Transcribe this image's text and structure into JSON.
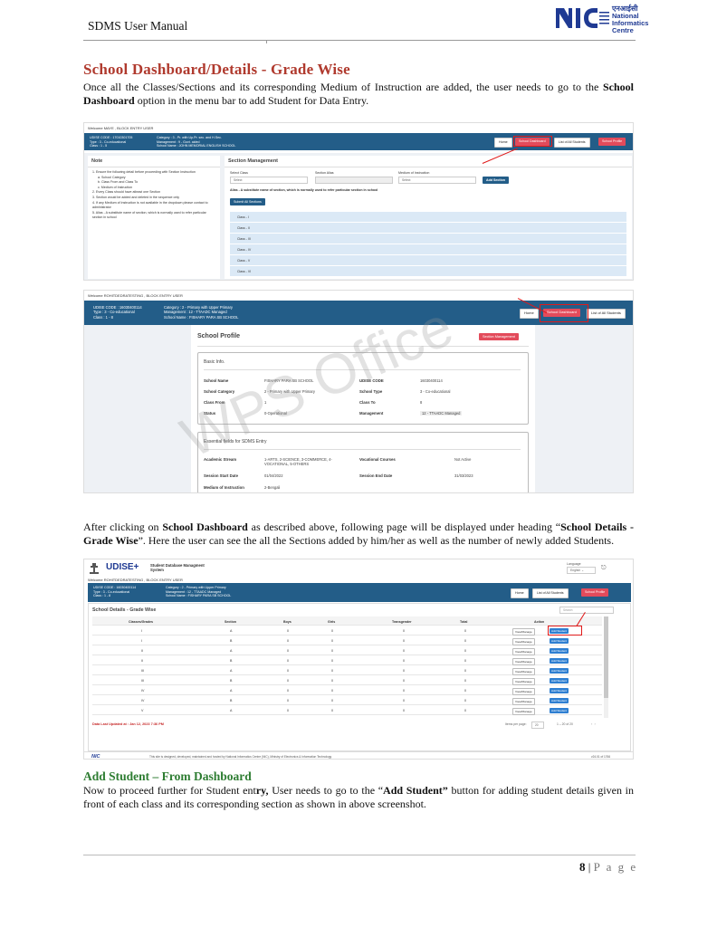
{
  "header": {
    "title": "SDMS User Manual",
    "logo_hindi": "एनआईसी",
    "logo_lines": [
      "National",
      "Informatics",
      "Centre"
    ]
  },
  "section_title": "School Dashboard/Details - Grade Wise",
  "para1": {
    "pre": "Once all the Classes/Sections and its corresponding Medium of Instruction are added, the user needs to go to the ",
    "bold": "School Dashboard",
    "post": " option in the menu bar to add Student for Data Entry."
  },
  "shot1": {
    "welcome": "Welcome MAYE , BLOCK ENTRY USER",
    "info_left": [
      "UDISE CODE : 17010301705",
      "Type : 3 - Co-educational",
      "Class : 1 - 5"
    ],
    "info_mid": [
      "Category : 3 - Pr. with Up.Pr. sec. and H.Sec.",
      "Management : 9 - Govt. aided",
      "School Name : JOHN MEMORIAL ENGLISH SCHOOL"
    ],
    "buttons": [
      "Home",
      "School Dashboard",
      "List of All Students",
      "School Profile"
    ],
    "note_title": "Note",
    "notes": [
      "1. Ensure the following detail before proceeding with Section Instruction",
      "a. School Category",
      "b. Class From and Class To",
      "c. Medium of Instruction",
      "2. Every Class should have atleast one Section",
      "3. Section would be added and deleted in the sequence only",
      "4. If any Medium of Instruction is not available in the dropdown please contact to administrator",
      "5. Alias - A substitute name of section, which is normally used to refer particular section in school"
    ],
    "section_title": "Section Management",
    "labels": [
      "Select Class",
      "Section Alias",
      "Medium of Instruction"
    ],
    "select": "Select",
    "add_section": "Add Section",
    "alias_note": "Alias - A substitute name of section, which is normally used to refer particular section in school",
    "submit": "Submit All Sections",
    "classes": [
      "Class - I",
      "Class - II",
      "Class - III",
      "Class - IV",
      "Class - V",
      "Class - VI"
    ]
  },
  "shot2": {
    "welcome": "Welcome ROHITDEDRATESTING , BLOCK ENTRY USER",
    "info_left": [
      "UDISE CODE : 16030400114",
      "Type : 3 - Co-educational",
      "Class : 1 - 8"
    ],
    "info_mid": [
      "Category : 2 - Primary with Upper Primary",
      "Management : 12 - TTAADC Managed",
      "School Name : FISHARY PARA SB SCHOOL"
    ],
    "buttons": [
      "Home",
      "School Dashboard",
      "List of All Students"
    ],
    "profile_title": "School Profile",
    "section_mgmt": "Section Management",
    "basic_info": "Basic Info.",
    "fields": [
      {
        "label": "School Name",
        "value": "FISHARY PARA SB SCHOOL",
        "label2": "UDISE CODE",
        "value2": "16030400114"
      },
      {
        "label": "School Category",
        "value": "2 - Primary with Upper Primary",
        "label2": "School Type",
        "value2": "3 - Co-educational"
      },
      {
        "label": "Class From",
        "value": "1",
        "label2": "Class To",
        "value2": "8"
      },
      {
        "label": "Status",
        "value": "0-Operational",
        "label2": "Management",
        "value2": "12 - TTAADC Managed"
      }
    ],
    "essential": "Essential fields for SDMS Entry",
    "fields2": [
      {
        "label": "Academic Stream",
        "value": "1-ARTS, 2-SCIENCE, 3-COMMERCE, 4-VOCATIONAL, 5-OTHERS",
        "label2": "Vocational Courses",
        "value2": "Not Active"
      },
      {
        "label": "Session Start Date",
        "value": "01/04/2022",
        "label2": "Session End Date",
        "value2": "31/03/2023"
      },
      {
        "label": "Medium of Instruction",
        "value": "2-Bengali",
        "label2": "",
        "value2": ""
      }
    ]
  },
  "watermark": "WPS Office",
  "para2": {
    "pre": "After clicking on ",
    "bold1": "School Dashboard",
    "mid": " as described above, following page will be displayed under heading “",
    "bold2": "School Details - Grade Wise",
    "post": "”. Here the user can see the all the Sections added by him/her as well as the number of newly added Students."
  },
  "shot3": {
    "app_name": "UDISE+",
    "app_sub": [
      "Student Database Managment",
      "System"
    ],
    "language_label": "Language",
    "language": "English",
    "welcome": "Welcome ROHITDEDRATESTING , BLOCK ENTRY USER",
    "info_left": [
      "UDISE CODE : 16030400114",
      "Type : 3 - Co-educational",
      "Class : 1 - 8"
    ],
    "info_mid": [
      "Category : 2 - Primary with Upper Primary",
      "Management : 12 - TTAADC Managed",
      "School Name : FISHARY PARA SB SCHOOL"
    ],
    "buttons": [
      "Home",
      "List of All Students",
      "School Profile"
    ],
    "table_title": "School Details - Grade Wise",
    "search": "Search",
    "columns": [
      "Classes/Grades",
      "Section",
      "Boys",
      "Girls",
      "Transgender",
      "Total",
      "Action"
    ],
    "rows": [
      [
        "I",
        "A",
        "0",
        "0",
        "0",
        "0"
      ],
      [
        "I",
        "B",
        "0",
        "0",
        "0",
        "0"
      ],
      [
        "II",
        "A",
        "0",
        "0",
        "0",
        "0"
      ],
      [
        "II",
        "B",
        "0",
        "0",
        "0",
        "0"
      ],
      [
        "III",
        "A",
        "0",
        "0",
        "0",
        "0"
      ],
      [
        "III",
        "B",
        "0",
        "0",
        "0",
        "0"
      ],
      [
        "IV",
        "A",
        "0",
        "0",
        "0",
        "0"
      ],
      [
        "IV",
        "B",
        "0",
        "0",
        "0",
        "0"
      ],
      [
        "V",
        "A",
        "0",
        "0",
        "0",
        "0"
      ]
    ],
    "view_manage": "View/Manage",
    "add_student": "Add Student",
    "last_updated": "Data Last Updated at : Jan 12, 2023 7:36 PM",
    "items_per_page_label": "Items per page:",
    "items_per_page": "20",
    "range": "1 – 20 of 20",
    "footer_text": "This site is designed, developed, maintained and hosted by National Informatics Centre (NIC), Ministry of Electronics & Information Technology",
    "version": "v24.01 of 1766"
  },
  "subheading": "Add Student – From Dashboard",
  "para3": {
    "pre": "Now to proceed further for Student ent",
    "bold1": "ry,",
    "mid": " User needs to go to the “",
    "bold2": "Add Student”",
    "post": " button for adding student details given in front of each class and its corresponding section as shown in above screenshot."
  },
  "footer": {
    "page_number": "8",
    "page_word": "P a g e"
  },
  "colors": {
    "heading": "#b03a2e",
    "subheading": "#2e7d32",
    "blue_bar": "#235d88",
    "highlight": "#e01a1a"
  }
}
